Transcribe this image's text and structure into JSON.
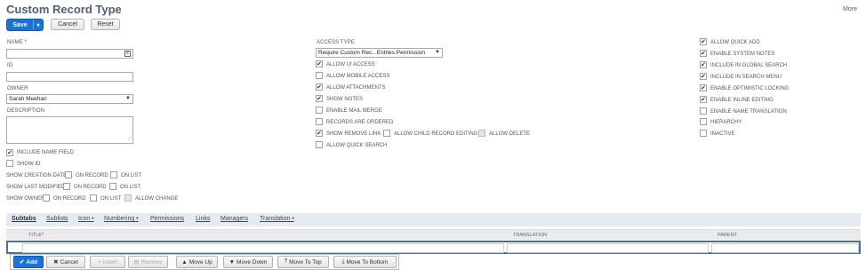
{
  "page": {
    "title": "Custom Record Type",
    "more_label": "More"
  },
  "toolbar": {
    "save_label": "Save",
    "save_menu": "▾",
    "cancel_label": "Cancel",
    "reset_label": "Reset"
  },
  "fields": {
    "name": {
      "label": "NAME",
      "required_mark": "*",
      "value": ""
    },
    "id": {
      "label": "ID",
      "value": ""
    },
    "owner": {
      "label": "OWNER",
      "value": "Sarah Meehan"
    },
    "description": {
      "label": "DESCRIPTION",
      "value": ""
    },
    "access_type": {
      "label": "ACCESS TYPE",
      "value": "Require Custom Rec...Entries Permission"
    }
  },
  "left_checks": {
    "include_name_field": {
      "label": "INCLUDE NAME FIELD",
      "checked": true
    },
    "show_id": {
      "label": "SHOW ID",
      "checked": false
    }
  },
  "show_rows": {
    "creation": {
      "label": "SHOW CREATION DATE",
      "on_record": "ON RECORD",
      "on_list": "ON LIST"
    },
    "modified": {
      "label": "SHOW LAST MODIFIED",
      "on_record": "ON RECORD",
      "on_list": "ON LIST"
    },
    "owner": {
      "label": "SHOW OWNER",
      "on_record": "ON RECORD",
      "on_list": "ON LIST",
      "allow_change": "ALLOW CHANGE"
    }
  },
  "middle_checks": [
    {
      "label": "ALLOW UI ACCESS",
      "checked": true
    },
    {
      "label": "ALLOW MOBILE ACCESS",
      "checked": false
    },
    {
      "label": "ALLOW ATTACHMENTS",
      "checked": true
    },
    {
      "label": "SHOW NOTES",
      "checked": true
    },
    {
      "label": "ENABLE MAIL MERGE",
      "checked": false
    },
    {
      "label": "RECORDS ARE ORDERED",
      "checked": false
    },
    {
      "label": "SHOW REMOVE LINK",
      "checked": true
    },
    {
      "label": "ALLOW QUICK SEARCH",
      "checked": false
    }
  ],
  "middle_inline": {
    "child_editing": "ALLOW CHILD RECORD EDITING",
    "allow_delete": "ALLOW DELETE"
  },
  "right_checks": [
    {
      "label": "ALLOW QUICK ADD",
      "checked": true
    },
    {
      "label": "ENABLE SYSTEM NOTES",
      "checked": true
    },
    {
      "label": "INCLUDE IN GLOBAL SEARCH",
      "checked": true
    },
    {
      "label": "INCLUDE IN SEARCH MENU",
      "checked": true
    },
    {
      "label": "ENABLE OPTIMISTIC LOCKING",
      "checked": true
    },
    {
      "label": "ENABLE INLINE EDITING",
      "checked": true
    },
    {
      "label": "ENABLE NAME TRANSLATION",
      "checked": false
    },
    {
      "label": "HIERARCHY",
      "checked": false
    },
    {
      "label": "INACTIVE",
      "checked": false
    }
  ],
  "tabs": [
    "Subtabs",
    "Sublists",
    "Icon •",
    "Numbering •",
    "Permissions",
    "Links",
    "Managers",
    "Translation •"
  ],
  "grid": {
    "col_title": "TITLE",
    "col_title_req": "*",
    "col_translation": "TRANSLATION",
    "col_parent": "PARENT"
  },
  "sublist_buttons": {
    "add": "Add",
    "cancel": "Cancel",
    "insert": "Insert",
    "remove": "Remove",
    "move_up": "Move Up",
    "move_down": "Move Down",
    "move_top": "Move To Top",
    "move_bottom": "Move To Bottom"
  },
  "check_glyph": "✔"
}
